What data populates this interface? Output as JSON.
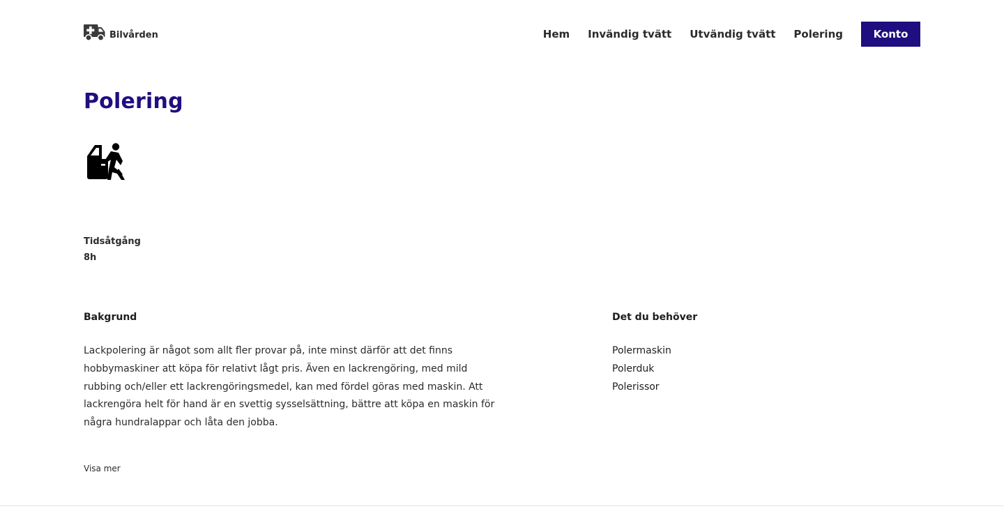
{
  "header": {
    "logo_text": "Bilvården",
    "logo_icon": "ambulance-truck-icon",
    "nav": {
      "items": [
        "Hem",
        "Invändig tvätt",
        "Utvändig tvätt",
        "Polering"
      ],
      "account_label": "Konto"
    }
  },
  "main": {
    "title": "Polering",
    "service_icon": "car-polishing-icon",
    "time": {
      "label": "Tidsåtgång",
      "value": "8h"
    },
    "background": {
      "heading": "Bakgrund",
      "text": "Lackpolering är något som allt fler provar på, inte minst därför att det finns hobbymaskiner att köpa för relativt lågt pris. Även en lackrengöring, med mild rubbing och/eller ett lackrengöringsmedel, kan med fördel göras med maskin. Att lackrengöra helt för hand är en svettig sysselsättning, bättre att köpa en maskin för några hundralappar och låta den jobba.",
      "show_more": "Visa mer"
    },
    "needs": {
      "heading": "Det du behöver",
      "items": [
        "Polermaskin",
        "Polerduk",
        "Polerissor"
      ]
    }
  },
  "colors": {
    "brand": "#1f0e7f",
    "text": "#2b2b2b",
    "button_text": "#ffffff",
    "divider": "#e2e2e2"
  }
}
